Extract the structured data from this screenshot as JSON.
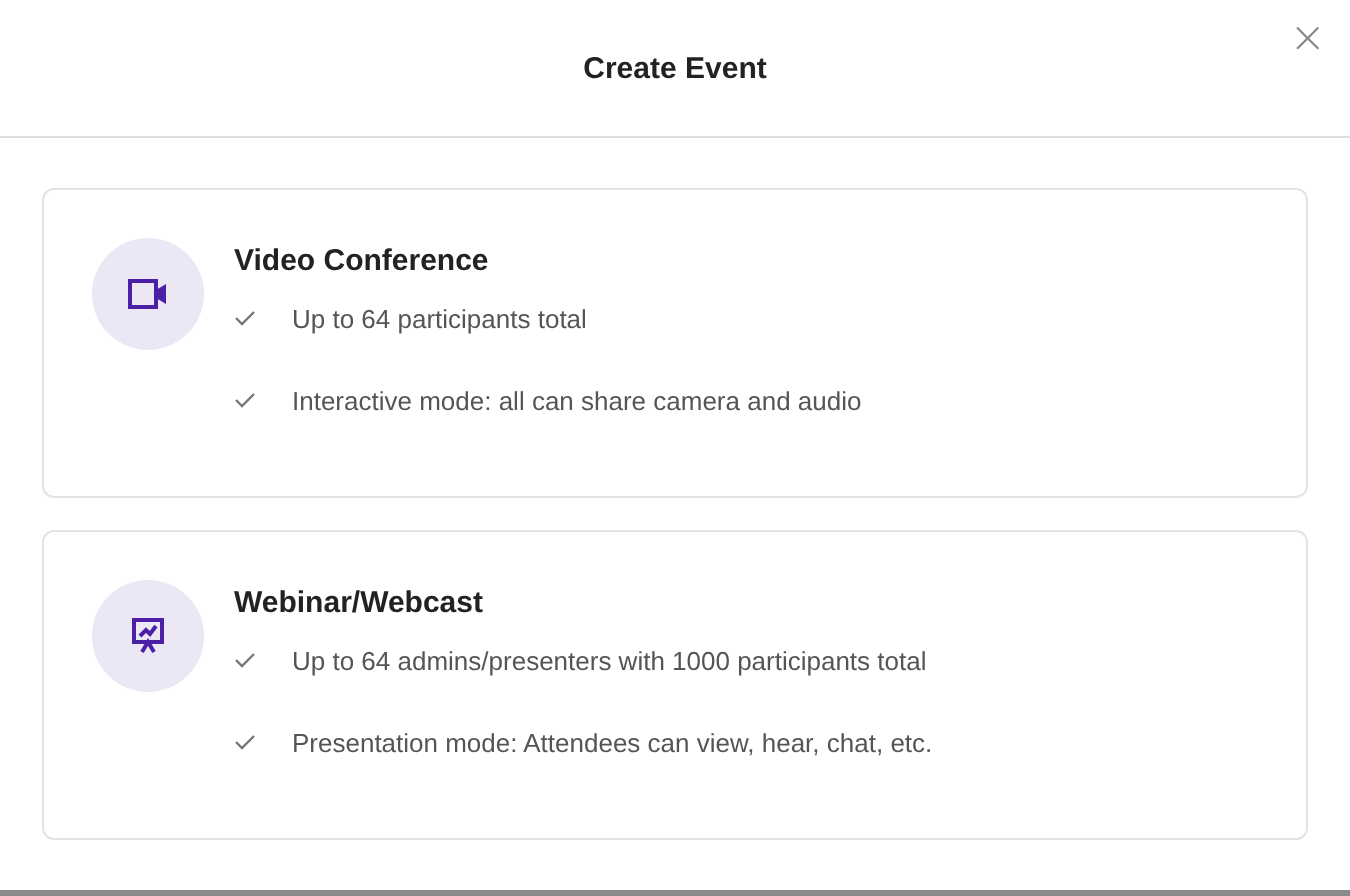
{
  "dialog": {
    "title": "Create Event",
    "close": "×"
  },
  "options": [
    {
      "kind": "video",
      "title": "Video Conference",
      "features": [
        "Up to 64 participants total",
        "Interactive mode: all can share camera and audio"
      ]
    },
    {
      "kind": "webinar",
      "title": "Webinar/Webcast",
      "features": [
        "Up to 64 admins/presenters with 1000 participants total",
        "Presentation mode: Attendees can view, hear, chat, etc."
      ]
    }
  ]
}
